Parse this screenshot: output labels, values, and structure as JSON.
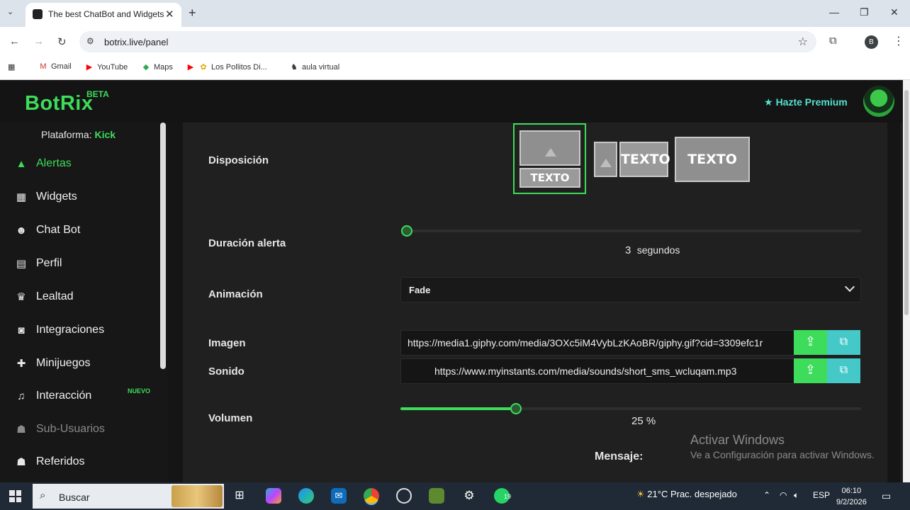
{
  "browser": {
    "tab_title": "The best ChatBot and Widgets",
    "url": "botrix.live/panel",
    "profile_initial": "B",
    "bookmarks": [
      "Gmail",
      "YouTube",
      "Maps",
      "Los Pollitos Di...",
      "aula virtual"
    ]
  },
  "app": {
    "logo": "BotRix",
    "beta": "BETA",
    "premium_label": "Hazte Premium"
  },
  "sidebar": {
    "platform_label": "Plataforma:",
    "platform_value": "Kick",
    "items": [
      {
        "label": "Alertas",
        "icon": "warning-icon"
      },
      {
        "label": "Widgets",
        "icon": "grid-icon"
      },
      {
        "label": "Chat Bot",
        "icon": "robot-icon"
      },
      {
        "label": "Perfil",
        "icon": "id-card-icon"
      },
      {
        "label": "Lealtad",
        "icon": "trophy-icon"
      },
      {
        "label": "Integraciones",
        "icon": "integration-icon"
      },
      {
        "label": "Minijuegos",
        "icon": "gamepad-icon"
      },
      {
        "label": "Interacción",
        "icon": "music-icon"
      },
      {
        "label": "Sub-Usuarios",
        "icon": "users-icon"
      },
      {
        "label": "Referidos",
        "icon": "group-icon"
      }
    ],
    "new_badge": "NUEVO"
  },
  "form": {
    "layout_label": "Disposición",
    "layout_text": "TEXTO",
    "duration_label": "Duración alerta",
    "duration_value": "3",
    "duration_unit": "segundos",
    "duration_fraction": 0.0,
    "animation_label": "Animación",
    "animation_value": "Fade",
    "image_label": "Imagen",
    "image_url": "https://media1.giphy.com/media/3OXc5iM4VybLzKAoBR/giphy.gif?cid=3309efc1r",
    "sound_label": "Sonido",
    "sound_url": "https://www.myinstants.com/media/sounds/short_sms_wcluqam.mp3",
    "volume_label": "Volumen",
    "volume_value": "25",
    "volume_unit": "%",
    "volume_fraction": 0.25,
    "message_label": "Mensaje:"
  },
  "watermark": {
    "line1": "Activar Windows",
    "line2": "Ve a Configuración para activar Windows."
  },
  "taskbar": {
    "search_placeholder": "Buscar",
    "weather": "21°C  Prac. despejado",
    "language": "ESP",
    "time": "06:10",
    "date": "9/2/2026",
    "whatsapp_badge": "19",
    "notifications": "6"
  }
}
